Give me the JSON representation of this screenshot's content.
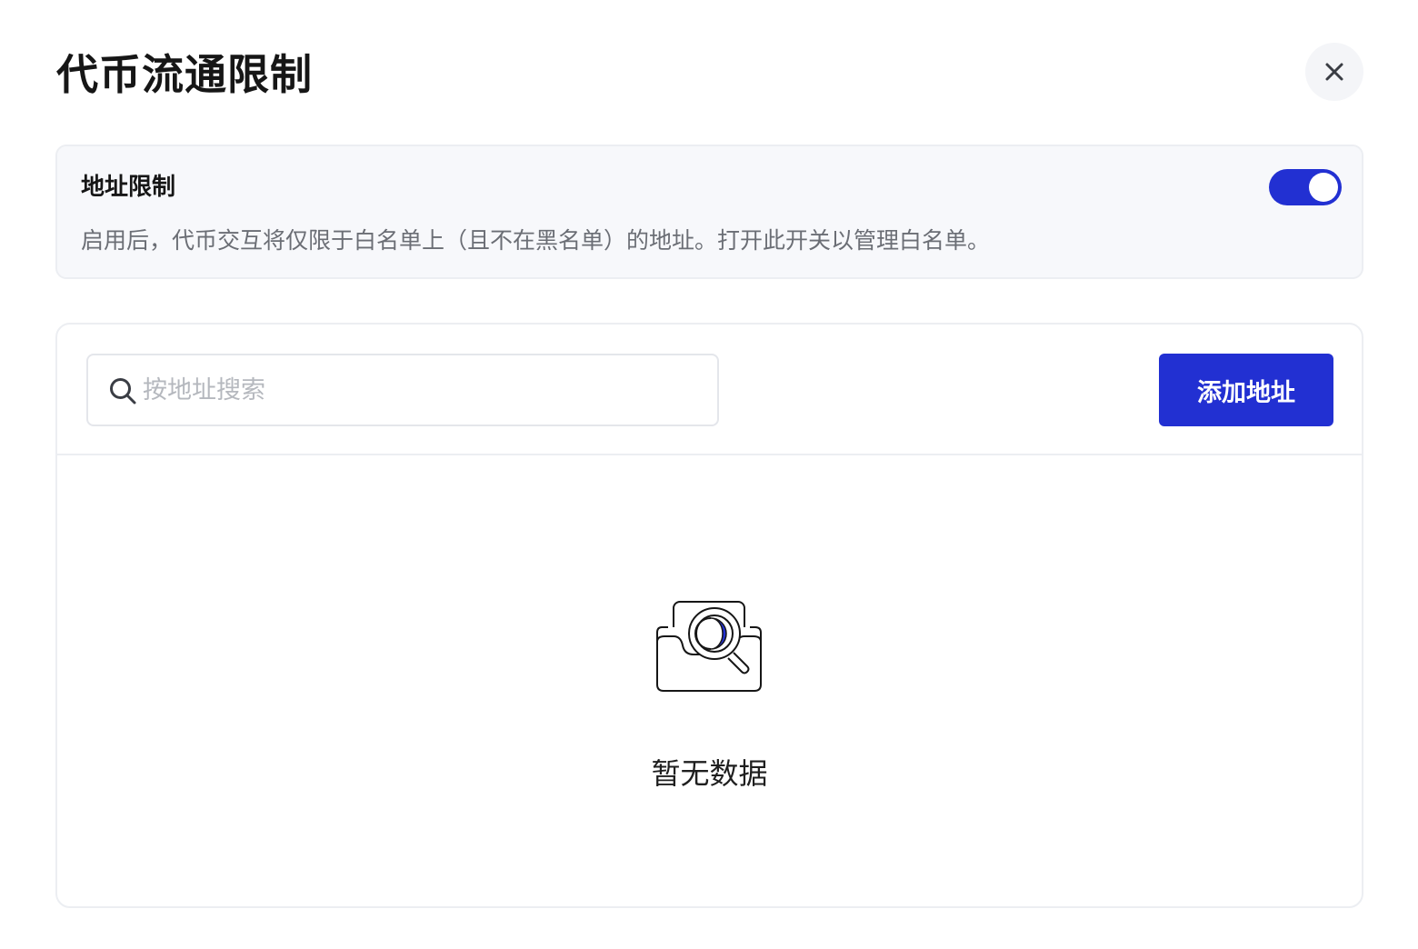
{
  "modal": {
    "title": "代币流通限制",
    "close_icon": "close-icon"
  },
  "restriction": {
    "title": "地址限制",
    "description": "启用后，代币交互将仅限于白名单上（且不在黑名单）的地址。打开此开关以管理白名单。",
    "toggle_on": true,
    "toggle_color": "#2230d2"
  },
  "toolbar": {
    "search_placeholder": "按地址搜索",
    "search_value": "",
    "search_icon": "search-icon",
    "add_button_label": "添加地址",
    "add_button_color": "#2230d2"
  },
  "empty": {
    "icon": "empty-box-magnifier-icon",
    "text": "暂无数据"
  }
}
